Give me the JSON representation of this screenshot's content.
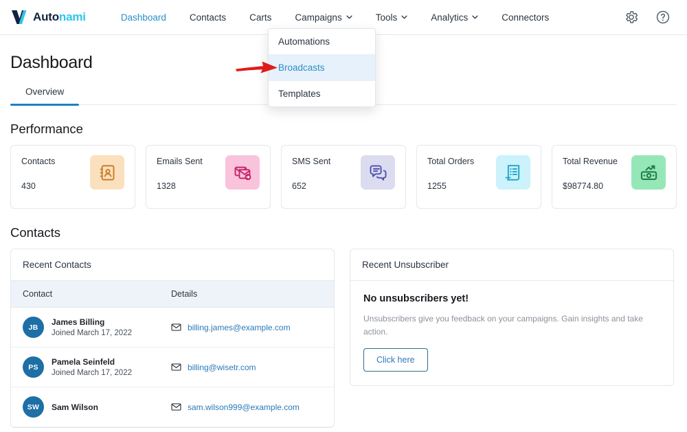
{
  "brand": {
    "name_dark": "Auto",
    "name_accent": "nami",
    "logo_icon": "autonami-v-logo-icon"
  },
  "nav": {
    "items": [
      {
        "label": "Dashboard",
        "active": true,
        "has_caret": false
      },
      {
        "label": "Contacts",
        "active": false,
        "has_caret": false
      },
      {
        "label": "Carts",
        "active": false,
        "has_caret": false
      },
      {
        "label": "Campaigns",
        "active": false,
        "has_caret": true
      },
      {
        "label": "Tools",
        "active": false,
        "has_caret": true
      },
      {
        "label": "Analytics",
        "active": false,
        "has_caret": true
      },
      {
        "label": "Connectors",
        "active": false,
        "has_caret": false
      }
    ],
    "right_icons": [
      {
        "name": "gear-icon"
      },
      {
        "name": "help-circle-icon"
      }
    ]
  },
  "dropdown": {
    "open_for": "Campaigns",
    "items": [
      {
        "label": "Automations",
        "highlighted": false
      },
      {
        "label": "Broadcasts",
        "highlighted": true
      },
      {
        "label": "Templates",
        "highlighted": false
      }
    ],
    "annotation": "red-arrow-pointing-at-broadcasts"
  },
  "page": {
    "title": "Dashboard",
    "tabs": [
      {
        "label": "Overview",
        "active": true
      }
    ]
  },
  "performance": {
    "section_title": "Performance",
    "cards": [
      {
        "label": "Contacts",
        "value": "430",
        "icon": "contact-book-icon",
        "icon_bg": "#fbe0bd",
        "icon_color": "#c77c2b"
      },
      {
        "label": "Emails Sent",
        "value": "1328",
        "icon": "email-send-icon",
        "icon_bg": "#f9c3dc",
        "icon_color": "#c8246b"
      },
      {
        "label": "SMS Sent",
        "value": "652",
        "icon": "chat-bubbles-icon",
        "icon_bg": "#dcdcf0",
        "icon_color": "#4f4fae"
      },
      {
        "label": "Total Orders",
        "value": "1255",
        "icon": "receipt-list-icon",
        "icon_bg": "#ccf2fb",
        "icon_color": "#1ba5cc"
      },
      {
        "label": "Total Revenue",
        "value": "$98774.80",
        "icon": "money-growth-icon",
        "icon_bg": "#96e7b8",
        "icon_color": "#1e7a48"
      }
    ]
  },
  "contacts_section": {
    "section_title": "Contacts",
    "recent_contacts": {
      "panel_title": "Recent Contacts",
      "columns": [
        "Contact",
        "Details"
      ],
      "rows": [
        {
          "initials": "JB",
          "name": "James Billing",
          "joined": "Joined March 17, 2022",
          "email": "billing.james@example.com"
        },
        {
          "initials": "PS",
          "name": "Pamela Seinfeld",
          "joined": "Joined March 17, 2022",
          "email": "billing@wisetr.com"
        },
        {
          "initials": "SW",
          "name": "Sam Wilson",
          "joined": "",
          "email": "sam.wilson999@example.com"
        }
      ]
    },
    "recent_unsubscriber": {
      "panel_title": "Recent Unsubscriber",
      "empty_title": "No unsubscribers yet!",
      "empty_description": "Unsubscribers give you feedback on your campaigns. Gain insights and take action.",
      "cta_label": "Click here"
    }
  },
  "colors": {
    "accent_blue": "#2b8fc7",
    "brand_cyan": "#2fc5e8",
    "brand_navy": "#11243f",
    "tab_underline": "#1e7fc2",
    "link_blue": "#2b79b8",
    "annotation_red": "#e01b1b",
    "table_header_bg": "#eef3f9",
    "dropdown_highlight_bg": "#e7f1fb"
  }
}
